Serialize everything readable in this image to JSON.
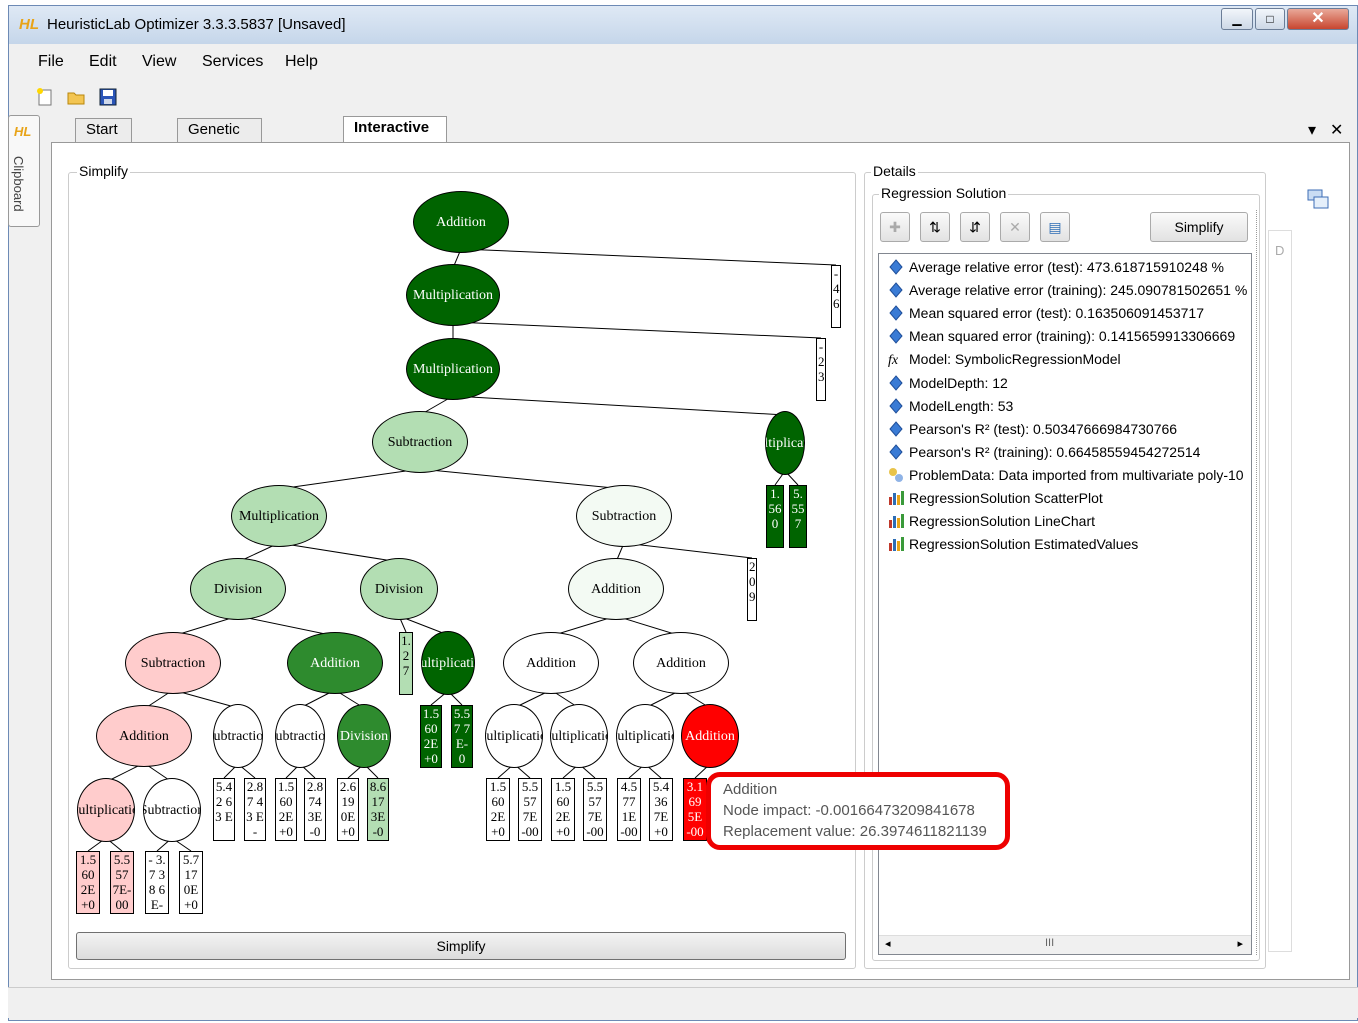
{
  "window": {
    "logo": "HL",
    "title": "HeuristicLab Optimizer 3.3.3.5837 [Unsaved]"
  },
  "menu": {
    "file": "File",
    "edit": "Edit",
    "view": "View",
    "services": "Services",
    "help": "Help"
  },
  "sidebar": {
    "logo": "HL",
    "clipboard": "Clipboard"
  },
  "tabs": [
    {
      "label": "Start Page"
    },
    {
      "label": "Genetic Algorithm"
    },
    {
      "label": "Interactive Regression Solutio..."
    }
  ],
  "simplify_panel": {
    "title": "Simplify",
    "button": "Simplify"
  },
  "details_panel": {
    "title": "Details",
    "group": "Regression Solution",
    "simplify_button": "Simplify",
    "scroll_thumb": "III",
    "side_glyphs": "D"
  },
  "properties": [
    {
      "icon": "diamond-icon",
      "text": "Average relative error (test): 473.618715910248 %"
    },
    {
      "icon": "diamond-icon",
      "text": "Average relative error (training): 245.090781502651 %"
    },
    {
      "icon": "diamond-icon",
      "text": "Mean squared error (test): 0.163506091453717"
    },
    {
      "icon": "diamond-icon",
      "text": "Mean squared error (training): 0.1415659913306669"
    },
    {
      "icon": "fx-icon",
      "text": "Model: SymbolicRegressionModel"
    },
    {
      "icon": "diamond-icon",
      "text": "ModelDepth: 12"
    },
    {
      "icon": "diamond-icon",
      "text": "ModelLength: 53"
    },
    {
      "icon": "diamond-icon",
      "text": "Pearson's R² (test): 0.50347666984730766"
    },
    {
      "icon": "diamond-icon",
      "text": "Pearson's R² (training): 0.66458559454272514"
    },
    {
      "icon": "data-icon",
      "text": "ProblemData: Data imported from multivariate poly-10"
    },
    {
      "icon": "chart-icon",
      "text": "RegressionSolution ScatterPlot"
    },
    {
      "icon": "chart-icon",
      "text": "RegressionSolution LineChart"
    },
    {
      "icon": "chart-icon",
      "text": "RegressionSolution EstimatedValues"
    }
  ],
  "tooltip": {
    "title": "Addition",
    "impact": "Node impact: -0.00166473209841678",
    "replacement": "Replacement value: 26.3974611821139"
  },
  "colors": {
    "dark_green": "#006400",
    "green": "#2e8b2e",
    "light_green": "#b3deb3",
    "pale_green": "#f3faf3",
    "pink": "#ffcccc",
    "red": "#ff0000"
  },
  "tree": {
    "nodes": [
      {
        "label": "Addition",
        "color": "dark_green"
      },
      {
        "label": "Multiplication",
        "color": "dark_green"
      },
      {
        "label": "Multiplication",
        "color": "dark_green"
      },
      {
        "label": "Subtraction",
        "color": "light_green"
      },
      {
        "label": "Multiplication",
        "color": "dark_green"
      },
      {
        "label": "Multiplication",
        "color": "light_green"
      },
      {
        "label": "Subtraction",
        "color": "pale_green"
      },
      {
        "label": "Division",
        "color": "light_green"
      },
      {
        "label": "Division",
        "color": "light_green"
      },
      {
        "label": "Addition",
        "color": "pale_green"
      },
      {
        "label": "Subtraction",
        "color": "pink"
      },
      {
        "label": "Addition",
        "color": "green"
      },
      {
        "label": "Multiplication",
        "color": "dark_green"
      },
      {
        "label": "Addition",
        "color": "white"
      },
      {
        "label": "Addition",
        "color": "white"
      },
      {
        "label": "Addition",
        "color": "pink"
      },
      {
        "label": "Subtraction",
        "color": "white"
      },
      {
        "label": "Subtraction",
        "color": "white"
      },
      {
        "label": "Division",
        "color": "green"
      },
      {
        "label": "Multiplication",
        "color": "white"
      },
      {
        "label": "Multiplication",
        "color": "white"
      },
      {
        "label": "Multiplication",
        "color": "white"
      },
      {
        "label": "Addition",
        "color": "red"
      },
      {
        "label": "Multiplication",
        "color": "pink"
      },
      {
        "label": "Subtraction",
        "color": "white"
      }
    ],
    "leaves": [
      {
        "text": "-4.6",
        "color": "white"
      },
      {
        "text": "-2.3",
        "color": "white"
      },
      {
        "text": "1.560",
        "color": "dark_green"
      },
      {
        "text": "5.557",
        "color": "dark_green"
      },
      {
        "text": "2.09",
        "color": "white"
      },
      {
        "text": "1.27",
        "color": "light_green"
      },
      {
        "text": "1.560 2E+0",
        "color": "dark_green"
      },
      {
        "text": "5.57 7E-0",
        "color": "dark_green"
      },
      {
        "text": "5.42 63 E",
        "color": "white"
      },
      {
        "text": "2.87 43 E-",
        "color": "white"
      },
      {
        "text": "1.5 60 2E +0",
        "color": "white"
      },
      {
        "text": "2.8 74 3E -0",
        "color": "white"
      },
      {
        "text": "2.6 19 0E +0",
        "color": "white"
      },
      {
        "text": "8.6 17 3E -0",
        "color": "light_green"
      },
      {
        "text": "1.5 60 2E +0",
        "color": "white"
      },
      {
        "text": "5.5 57 7E -00",
        "color": "white"
      },
      {
        "text": "1.5 60 2E +0",
        "color": "white"
      },
      {
        "text": "5.5 57 7E -00",
        "color": "white"
      },
      {
        "text": "4.5 77 1E -00",
        "color": "white"
      },
      {
        "text": "5.4 36 7E +0",
        "color": "white"
      },
      {
        "text": "3.1 69 5E -00",
        "color": "red"
      },
      {
        "text": "1.5 60 2E +0",
        "color": "pink"
      },
      {
        "text": "5.5 57 7E- 00",
        "color": "pink"
      },
      {
        "text": "- 3.7 38 6E-",
        "color": "white"
      },
      {
        "text": "5.7 17 0E +0",
        "color": "white"
      }
    ]
  }
}
